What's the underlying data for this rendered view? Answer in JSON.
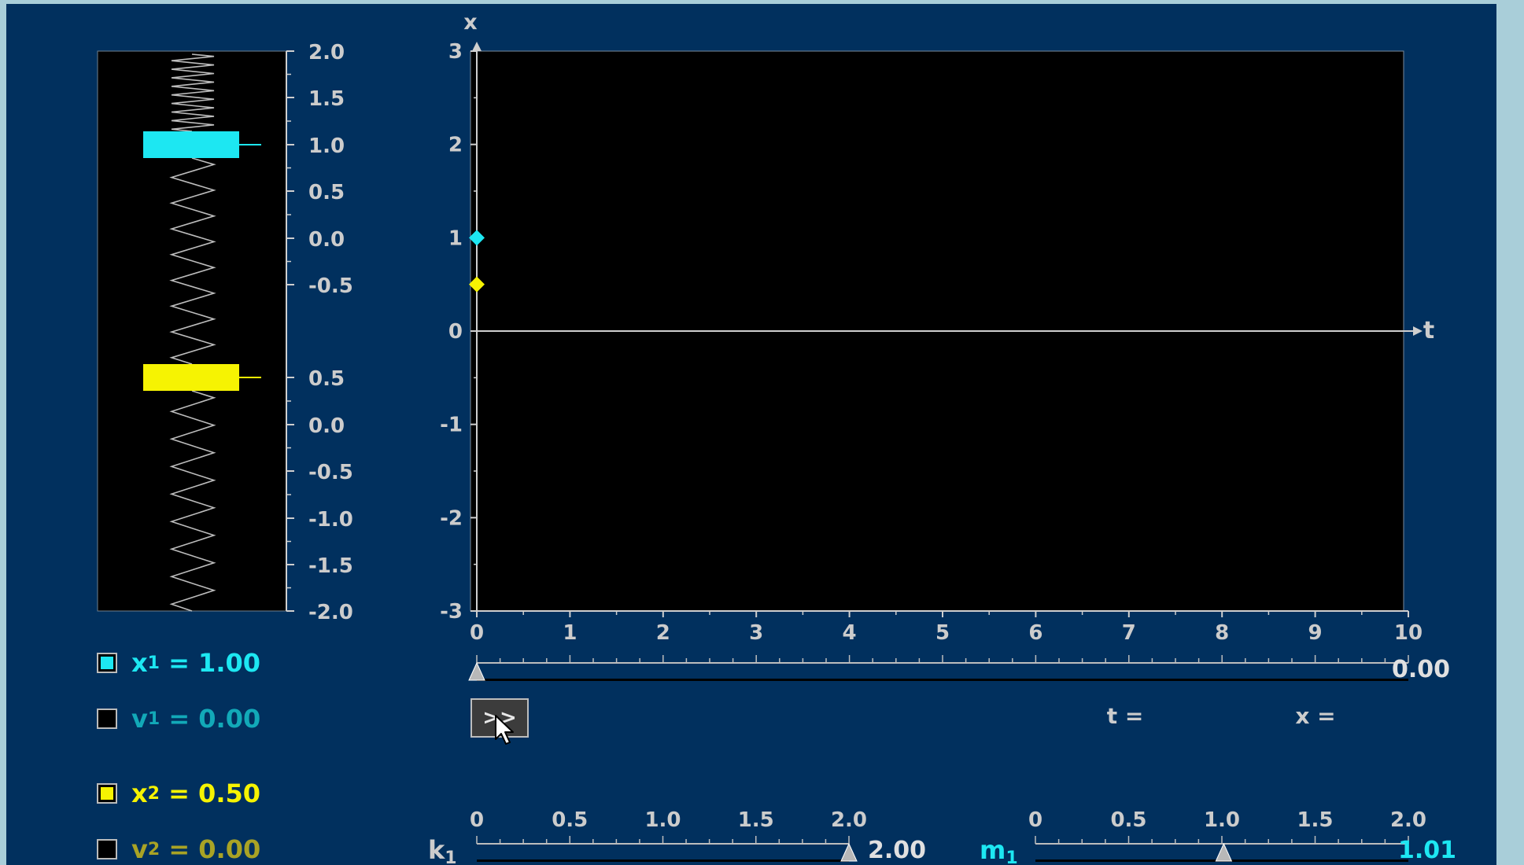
{
  "colors": {
    "panel_bg": "#01305e",
    "outer_bg": "#a9ced9",
    "mass1": "#1de7f2",
    "mass2": "#f6f302",
    "v1_text": "#12a9b8",
    "v2_text": "#a9a325",
    "axis": "#cfcfcf",
    "label": "#cccccc"
  },
  "spring_view": {
    "upper_ticks": [
      "2.0",
      "1.5",
      "1.0",
      "0.5",
      "0.0",
      "-0.5"
    ],
    "lower_ticks": [
      "0.5",
      "0.0",
      "-0.5",
      "-1.0",
      "-1.5",
      "-2.0"
    ]
  },
  "state": {
    "x1": {
      "label": "x",
      "sub": "1",
      "eq": "= 1.00",
      "checked": true
    },
    "v1": {
      "label": "v",
      "sub": "1",
      "eq": "= 0.00",
      "checked": false
    },
    "x2": {
      "label": "x",
      "sub": "2",
      "eq": "= 0.50",
      "checked": true
    },
    "v2": {
      "label": "v",
      "sub": "2",
      "eq": "= 0.00",
      "checked": false
    }
  },
  "chart_data": {
    "type": "scatter",
    "xlabel": "t",
    "ylabel": "x",
    "xlim": [
      0,
      10
    ],
    "ylim": [
      -3,
      3
    ],
    "x_ticks": [
      "0",
      "1",
      "2",
      "3",
      "4",
      "5",
      "6",
      "7",
      "8",
      "9",
      "10"
    ],
    "y_ticks": [
      "3",
      "2",
      "1",
      "0",
      "-1",
      "-2",
      "-3"
    ],
    "series": [
      {
        "color": "#1de7f2",
        "points": [
          [
            0,
            1.0
          ]
        ]
      },
      {
        "color": "#f6f302",
        "points": [
          [
            0,
            0.5
          ]
        ]
      }
    ],
    "grid": false
  },
  "time_slider": {
    "min": 0,
    "max": 10,
    "value": 0,
    "readout": "0.00"
  },
  "play_button": {
    "label": ">>"
  },
  "readouts": {
    "t_label": "t =",
    "x_label": "x ="
  },
  "k1_slider": {
    "label": "k",
    "sub": "1",
    "ticks": [
      "0",
      "0.5",
      "1.0",
      "1.5",
      "2.0"
    ],
    "min": 0,
    "max": 2,
    "value": 2.0,
    "readout": "2.00"
  },
  "m1_slider": {
    "label": "m",
    "sub": "1",
    "ticks": [
      "0",
      "0.5",
      "1.0",
      "1.5",
      "2.0"
    ],
    "min": 0,
    "max": 2,
    "value": 1.01,
    "readout": "1.01"
  }
}
